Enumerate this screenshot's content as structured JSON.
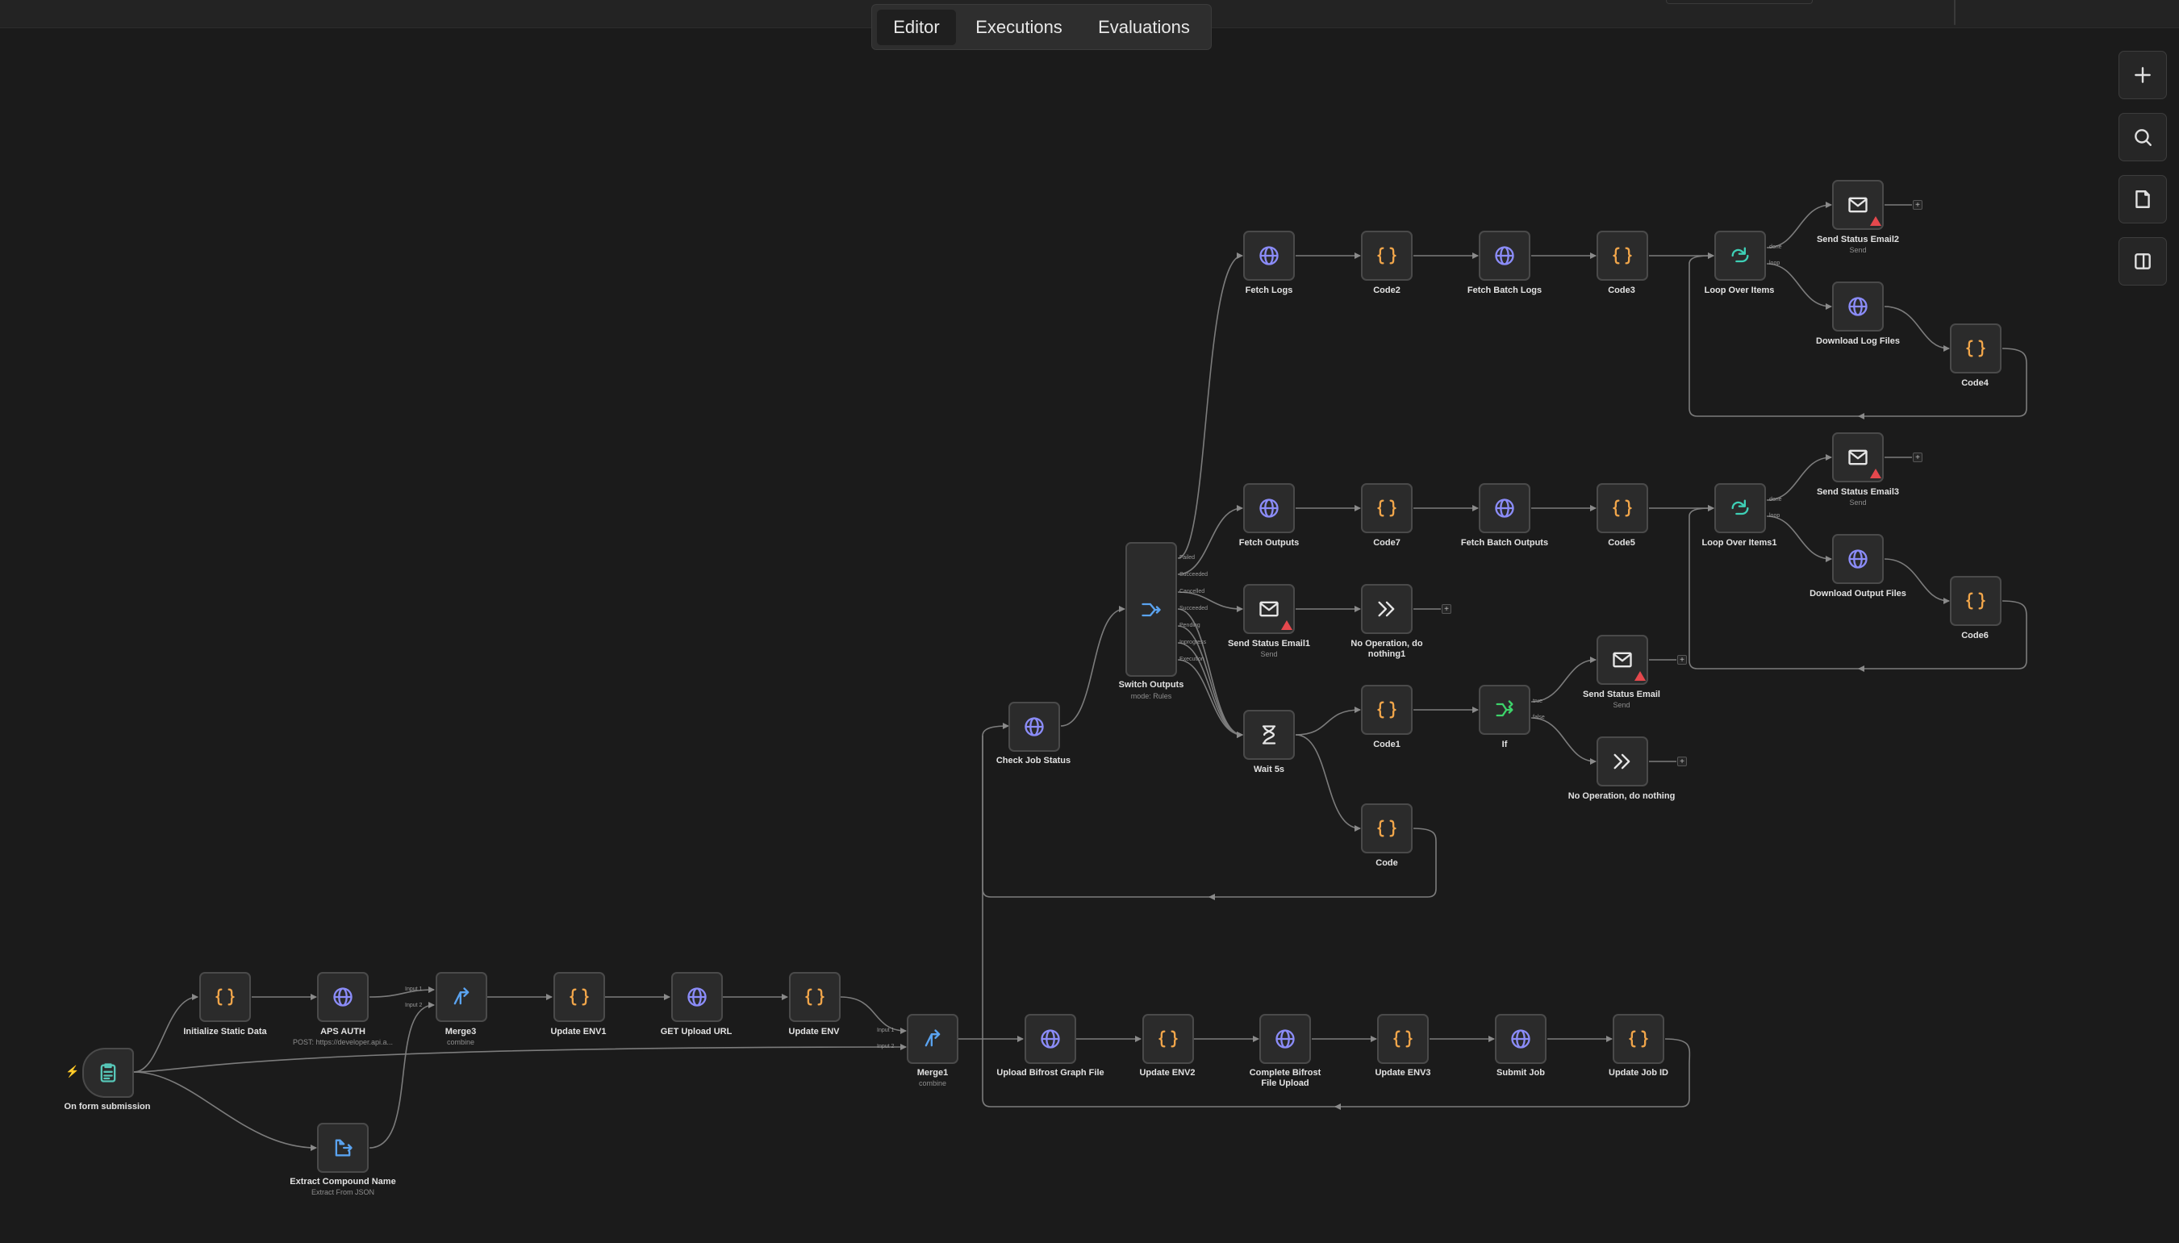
{
  "tabs": {
    "editor": "Editor",
    "executions": "Executions",
    "evaluations": "Evaluations"
  },
  "toolbar": {
    "zoom_in": "plus-icon",
    "search": "search-icon",
    "sticky": "sticky-note-icon",
    "panel": "panel-icon"
  },
  "colors": {
    "code": "#f0a54a",
    "http": "#8b8cf8",
    "merge": "#5aa3f0",
    "loop": "#3ed0b6",
    "if": "#3dd46a",
    "trigger": "#57c7b8",
    "warning": "#e5484d"
  },
  "nodes": {
    "initialize_static_data": {
      "label": "Initialize Static Data",
      "icon": "code-braces-icon"
    },
    "aps_auth": {
      "label": "APS AUTH",
      "sub": "POST: https://developer.api.a...",
      "icon": "globe-icon"
    },
    "merge3": {
      "label": "Merge3",
      "sub": "combine",
      "input1": "Input 1",
      "input2": "Input 2",
      "icon": "merge-icon"
    },
    "update_env1": {
      "label": "Update ENV1",
      "icon": "code-braces-icon"
    },
    "get_upload_url": {
      "label": "GET Upload URL",
      "icon": "globe-icon"
    },
    "update_env": {
      "label": "Update ENV",
      "icon": "code-braces-icon"
    },
    "on_form_submission": {
      "label": "On form submission",
      "icon": "form-icon"
    },
    "extract_compound_name": {
      "label": "Extract Compound Name",
      "sub": "Extract From JSON",
      "icon": "extract-icon"
    },
    "merge1": {
      "label": "Merge1",
      "sub": "combine",
      "input1": "Input 1",
      "input2": "Input 2",
      "icon": "merge-icon"
    },
    "upload_bifrost": {
      "label": "Upload Bifrost Graph File",
      "icon": "globe-icon"
    },
    "update_env2": {
      "label": "Update ENV2",
      "icon": "code-braces-icon"
    },
    "complete_bifrost": {
      "label": "Complete Bifrost File Upload",
      "icon": "globe-icon"
    },
    "update_env3": {
      "label": "Update ENV3",
      "icon": "code-braces-icon"
    },
    "submit_job": {
      "label": "Submit Job",
      "icon": "globe-icon"
    },
    "update_job_id": {
      "label": "Update Job ID",
      "icon": "code-braces-icon"
    },
    "check_job_status": {
      "label": "Check Job Status",
      "icon": "globe-icon"
    },
    "switch_outputs": {
      "label": "Switch Outputs",
      "sub": "mode: Rules",
      "icon": "switch-icon",
      "outputs": [
        "Failed",
        "Succeeded",
        "Cancelled",
        "Succeeded",
        "Pending",
        "Inprogress",
        "Execution"
      ]
    },
    "fetch_logs": {
      "label": "Fetch Logs",
      "icon": "globe-icon"
    },
    "code2": {
      "label": "Code2",
      "icon": "code-braces-icon"
    },
    "fetch_batch_logs": {
      "label": "Fetch Batch Logs",
      "icon": "globe-icon"
    },
    "code3": {
      "label": "Code3",
      "icon": "code-braces-icon"
    },
    "loop_over_items": {
      "label": "Loop Over Items",
      "done": "done",
      "loop": "loop",
      "icon": "loop-icon"
    },
    "send_status_email2": {
      "label": "Send Status Email2",
      "sub": "Send",
      "icon": "mail-icon"
    },
    "download_log_files": {
      "label": "Download Log Files",
      "icon": "globe-icon"
    },
    "code4": {
      "label": "Code4",
      "icon": "code-braces-icon"
    },
    "fetch_outputs": {
      "label": "Fetch Outputs",
      "icon": "globe-icon"
    },
    "code7": {
      "label": "Code7",
      "icon": "code-braces-icon"
    },
    "fetch_batch_outputs": {
      "label": "Fetch Batch Outputs",
      "icon": "globe-icon"
    },
    "code5": {
      "label": "Code5",
      "icon": "code-braces-icon"
    },
    "loop_over_items1": {
      "label": "Loop Over Items1",
      "done": "done",
      "loop": "loop",
      "icon": "loop-icon"
    },
    "send_status_email3": {
      "label": "Send Status Email3",
      "sub": "Send",
      "icon": "mail-icon"
    },
    "download_output_files": {
      "label": "Download Output Files",
      "icon": "globe-icon"
    },
    "code6": {
      "label": "Code6",
      "icon": "code-braces-icon"
    },
    "send_status_email1": {
      "label": "Send Status Email1",
      "sub": "Send",
      "icon": "mail-icon"
    },
    "noop1": {
      "label": "No Operation, do nothing1",
      "icon": "arrow-right-icon"
    },
    "wait5s": {
      "label": "Wait 5s",
      "icon": "hourglass-icon"
    },
    "code1": {
      "label": "Code1",
      "icon": "code-braces-icon"
    },
    "if": {
      "label": "If",
      "true": "true",
      "false": "false",
      "icon": "if-icon"
    },
    "send_status_email": {
      "label": "Send Status Email",
      "sub": "Send",
      "icon": "mail-icon"
    },
    "noop": {
      "label": "No Operation, do nothing",
      "icon": "arrow-right-icon"
    },
    "code": {
      "label": "Code",
      "icon": "code-braces-icon"
    }
  }
}
